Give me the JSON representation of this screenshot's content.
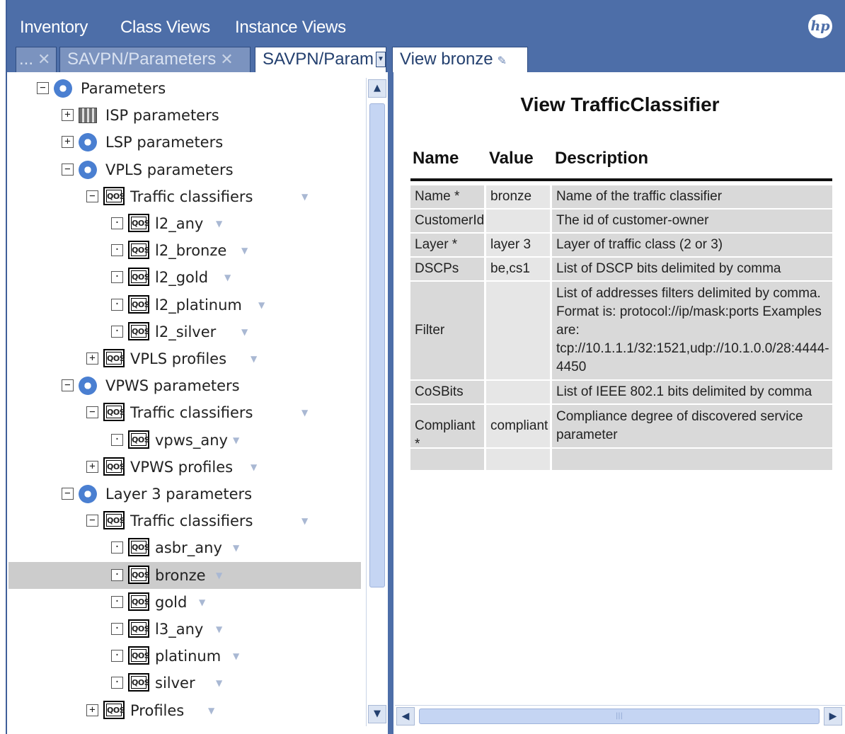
{
  "menu": {
    "inventory": "Inventory",
    "class_views": "Class Views",
    "instance_views": "Instance Views",
    "brand_icon": "hp-logo"
  },
  "tabs": {
    "overflow": "...",
    "tab1": "SAVPN/Parameters",
    "tab2": "SAVPN/Param",
    "tab3": "View bronze"
  },
  "tree": [
    {
      "label": "Parameters",
      "expander": "−",
      "icon": "gear-icon"
    },
    {
      "label": "ISP parameters",
      "expander": "+",
      "icon": "database-icon"
    },
    {
      "label": "LSP parameters",
      "expander": "+",
      "icon": "gear-icon"
    },
    {
      "label": "VPLS parameters",
      "expander": "−",
      "icon": "gear-icon"
    },
    {
      "label": "Traffic classifiers",
      "expander": "−",
      "icon": "qos-icon"
    },
    {
      "label": "l2_any",
      "expander": "·",
      "icon": "qos-icon"
    },
    {
      "label": "l2_bronze",
      "expander": "·",
      "icon": "qos-icon"
    },
    {
      "label": "l2_gold",
      "expander": "·",
      "icon": "qos-icon"
    },
    {
      "label": "l2_platinum",
      "expander": "·",
      "icon": "qos-icon"
    },
    {
      "label": "l2_silver",
      "expander": "·",
      "icon": "qos-icon"
    },
    {
      "label": "VPLS profiles",
      "expander": "+",
      "icon": "qos-icon"
    },
    {
      "label": "VPWS parameters",
      "expander": "−",
      "icon": "gear-icon"
    },
    {
      "label": "Traffic classifiers",
      "expander": "−",
      "icon": "qos-icon"
    },
    {
      "label": "vpws_any",
      "expander": "·",
      "icon": "qos-icon"
    },
    {
      "label": "VPWS profiles",
      "expander": "+",
      "icon": "qos-icon"
    },
    {
      "label": "Layer 3 parameters",
      "expander": "−",
      "icon": "gear-icon"
    },
    {
      "label": "Traffic classifiers",
      "expander": "−",
      "icon": "qos-icon"
    },
    {
      "label": "asbr_any",
      "expander": "·",
      "icon": "qos-icon"
    },
    {
      "label": "bronze",
      "expander": "·",
      "icon": "qos-icon"
    },
    {
      "label": "gold",
      "expander": "·",
      "icon": "qos-icon"
    },
    {
      "label": "l3_any",
      "expander": "·",
      "icon": "qos-icon"
    },
    {
      "label": "platinum",
      "expander": "·",
      "icon": "qos-icon"
    },
    {
      "label": "silver",
      "expander": "·",
      "icon": "qos-icon"
    },
    {
      "label": "Profiles",
      "expander": "+",
      "icon": "qos-icon"
    }
  ],
  "qos_icon_text": "QOS",
  "detail": {
    "title": "View TrafficClassifier",
    "columns": [
      "Name",
      "Value",
      "Description"
    ],
    "rows": [
      {
        "name": "Name *",
        "value": "bronze",
        "description": "Name of the traffic classifier"
      },
      {
        "name": "CustomerId",
        "value": "",
        "description": "The id of customer-owner"
      },
      {
        "name": "Layer *",
        "value": "layer 3",
        "description": "Layer of traffic class (2 or 3)"
      },
      {
        "name": "DSCPs",
        "value": "be,cs1",
        "description": "List of DSCP bits delimited by comma"
      },
      {
        "name": "Filter",
        "value": "",
        "description": "List of addresses filters delimited by comma. Format is: protocol://ip/mask:ports Examples are: tcp://10.1.1.1/32:1521,udp://10.1.0.0/28:4444-4450"
      },
      {
        "name": "CoSBits",
        "value": "",
        "description": "List of IEEE 802.1 bits delimited by comma"
      },
      {
        "name": "Compliant *",
        "value": "compliant",
        "description": "Compliance degree of discovered service parameter"
      },
      {
        "name": "",
        "value": "",
        "description": ""
      }
    ]
  },
  "colors": {
    "menubar": "#4d6ea8",
    "selected_row": "#cccccc",
    "table_cell": "#d9d9d9"
  }
}
